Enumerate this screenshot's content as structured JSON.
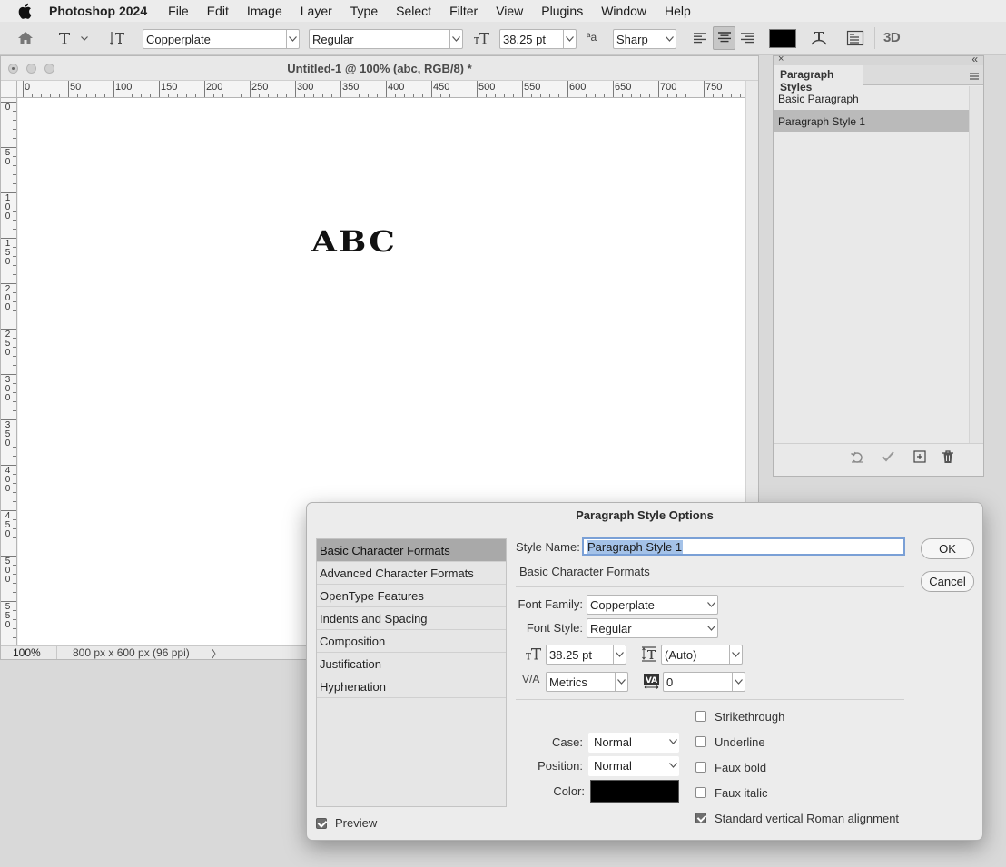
{
  "menubar": {
    "app_name": "Photoshop 2024",
    "items": [
      "File",
      "Edit",
      "Image",
      "Layer",
      "Type",
      "Select",
      "Filter",
      "View",
      "Plugins",
      "Window",
      "Help"
    ]
  },
  "options_bar": {
    "font_family": "Copperplate",
    "font_style": "Regular",
    "font_size": "38.25 pt",
    "antialias_glyph": "ªa",
    "antialias": "Sharp",
    "three_d_label": "3D",
    "text_color": "#000000"
  },
  "document": {
    "title": "Untitled-1 @ 100% (abc, RGB/8) *",
    "canvas_text": "ABC",
    "zoom": "100%",
    "doc_info": "800 px x 600 px (96 ppi)",
    "status_arrow": "〉",
    "h_ruler_labels": [
      "0",
      "50",
      "100",
      "150",
      "200",
      "250",
      "300",
      "350",
      "400",
      "450",
      "500",
      "550",
      "600",
      "650",
      "700",
      "750"
    ],
    "v_ruler_labels": [
      "0",
      "50",
      "100",
      "150",
      "200",
      "250",
      "300",
      "350",
      "400",
      "450",
      "500",
      "550"
    ]
  },
  "paragraph_styles_panel": {
    "close_glyph": "×",
    "collapse_glyph": "«",
    "tab": "Paragraph Styles",
    "items": [
      "Basic Paragraph",
      "Paragraph Style 1"
    ],
    "selected_index": 1
  },
  "dialog": {
    "title": "Paragraph Style Options",
    "categories": [
      "Basic Character Formats",
      "Advanced Character Formats",
      "OpenType Features",
      "Indents and Spacing",
      "Composition",
      "Justification",
      "Hyphenation"
    ],
    "selected_category": 0,
    "style_name_label": "Style Name:",
    "style_name_value": "Paragraph Style 1",
    "section_title": "Basic Character Formats",
    "font_family_label": "Font Family:",
    "font_family_value": "Copperplate",
    "font_style_label": "Font Style:",
    "font_style_value": "Regular",
    "size_value": "38.25 pt",
    "leading_value": "(Auto)",
    "kerning_value": "Metrics",
    "tracking_value": "0",
    "case_label": "Case:",
    "case_value": "Normal",
    "position_label": "Position:",
    "position_value": "Normal",
    "color_label": "Color:",
    "color_value": "#000000",
    "checkboxes": [
      {
        "label": "Strikethrough",
        "checked": false
      },
      {
        "label": "Underline",
        "checked": false
      },
      {
        "label": "Faux bold",
        "checked": false
      },
      {
        "label": "Faux italic",
        "checked": false
      },
      {
        "label": "Standard vertical Roman alignment",
        "checked": true
      }
    ],
    "preview_label": "Preview",
    "preview_checked": true,
    "ok_label": "OK",
    "cancel_label": "Cancel"
  }
}
